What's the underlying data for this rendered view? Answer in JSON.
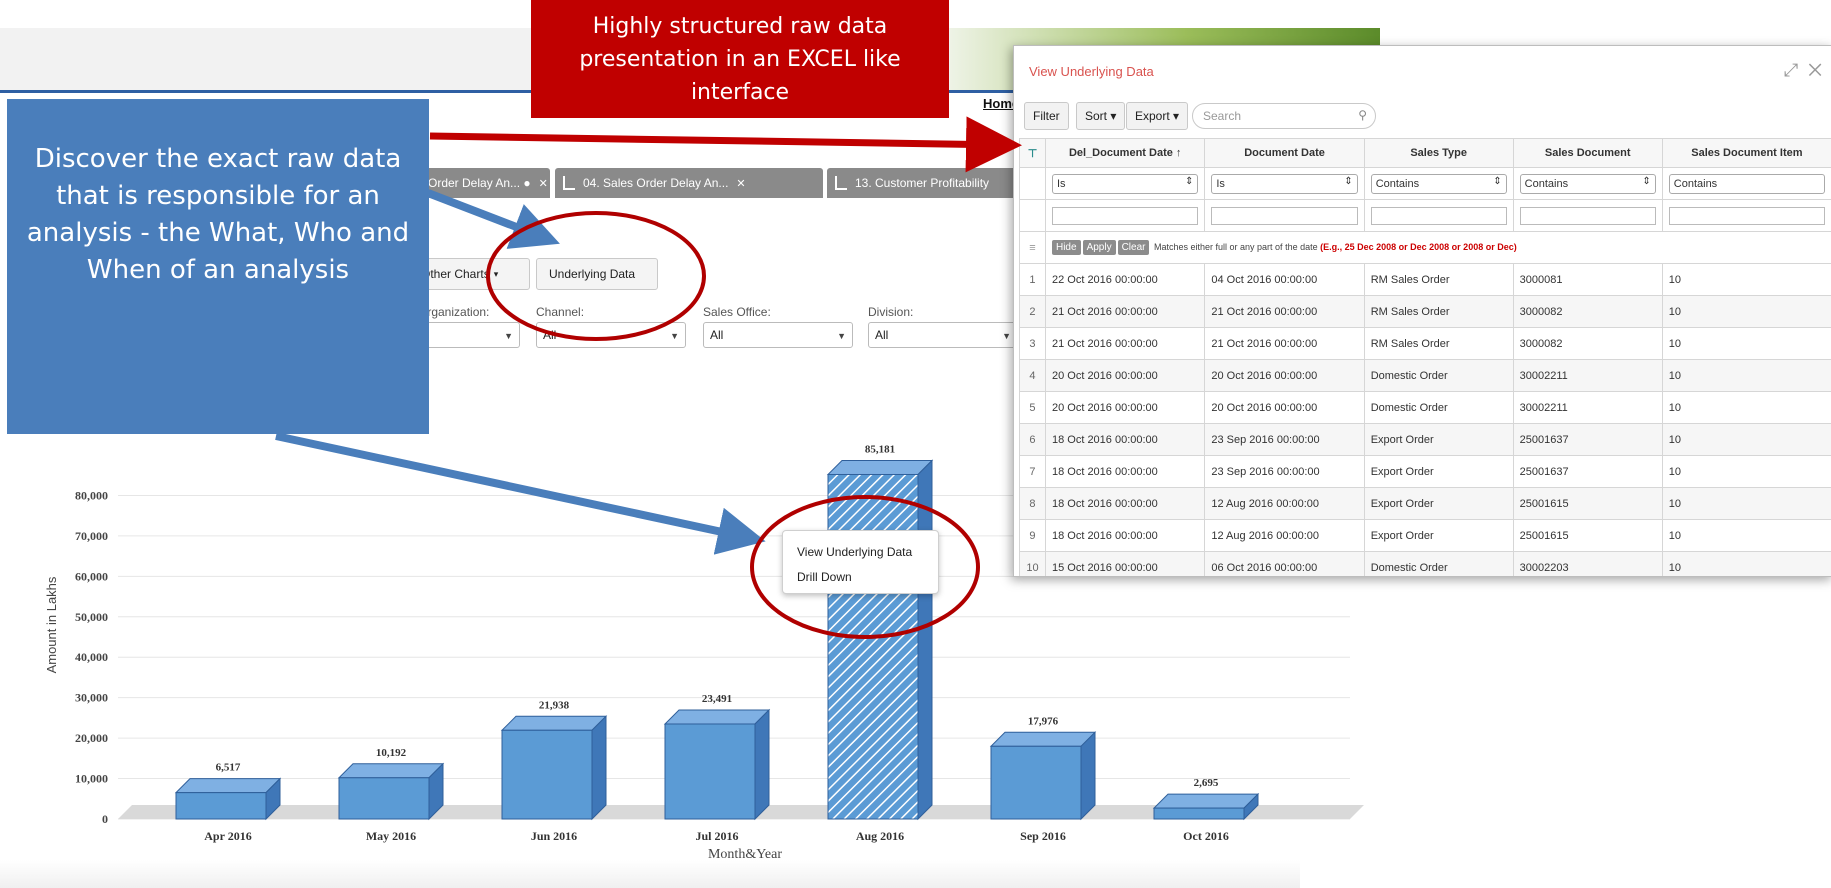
{
  "app": {
    "home_link": "Home",
    "tabs": [
      {
        "label": "Order Delay An... ●"
      },
      {
        "label": "04. Sales Order Delay An..."
      },
      {
        "label": "13. Customer Profitability"
      }
    ],
    "toolbar": {
      "other_charts": "Other Charts",
      "underlying_data": "Underlying Data"
    },
    "filters": [
      {
        "label": "Organization:",
        "value": ""
      },
      {
        "label": "Channel:",
        "value": "All"
      },
      {
        "label": "Sales Office:",
        "value": "All"
      },
      {
        "label": "Division:",
        "value": "All"
      }
    ]
  },
  "chart_data": {
    "type": "bar",
    "categories": [
      "Apr 2016",
      "May 2016",
      "Jun 2016",
      "Jul 2016",
      "Aug 2016",
      "Sep 2016",
      "Oct 2016"
    ],
    "values": [
      6517,
      10192,
      21938,
      23491,
      85181,
      17976,
      2695
    ],
    "data_labels": [
      "6,517",
      "10,192",
      "21,938",
      "23,491",
      "85,181",
      "17,976",
      "2,695"
    ],
    "xlabel": "Month&Year",
    "ylabel": "Amount in Lakhs",
    "yticks": [
      "0",
      "10,000",
      "20,000",
      "30,000",
      "40,000",
      "50,000",
      "60,000",
      "70,000",
      "80,000"
    ],
    "ylim": [
      0,
      90000
    ],
    "highlighted_category": "Aug 2016",
    "bar_color": "#5b9bd5",
    "grid": true
  },
  "context_menu": {
    "items": [
      "View Underlying Data",
      "Drill Down"
    ]
  },
  "data_window": {
    "title": "View Underlying Data",
    "buttons": {
      "filter": "Filter",
      "sort": "Sort ▾",
      "export": "Export ▾"
    },
    "search_placeholder": "Search",
    "columns": [
      "Del_Document Date ↑",
      "Document Date",
      "Sales Type",
      "Sales Document",
      "Sales Document Item"
    ],
    "filter_ops": [
      "Is",
      "Is",
      "Contains",
      "Contains",
      "Contains"
    ],
    "hint": {
      "buttons": [
        "Hide",
        "Apply",
        "Clear"
      ],
      "text": "Matches either full or any part of the date",
      "example": "(E.g., 25 Dec 2008 or Dec 2008 or 2008 or Dec)"
    },
    "rows": [
      [
        "1",
        "22 Oct 2016 00:00:00",
        "04 Oct 2016 00:00:00",
        "RM Sales Order",
        "3000081",
        "10"
      ],
      [
        "2",
        "21 Oct 2016 00:00:00",
        "21 Oct 2016 00:00:00",
        "RM Sales Order",
        "3000082",
        "10"
      ],
      [
        "3",
        "21 Oct 2016 00:00:00",
        "21 Oct 2016 00:00:00",
        "RM Sales Order",
        "3000082",
        "10"
      ],
      [
        "4",
        "20 Oct 2016 00:00:00",
        "20 Oct 2016 00:00:00",
        "Domestic Order",
        "30002211",
        "10"
      ],
      [
        "5",
        "20 Oct 2016 00:00:00",
        "20 Oct 2016 00:00:00",
        "Domestic Order",
        "30002211",
        "10"
      ],
      [
        "6",
        "18 Oct 2016 00:00:00",
        "23 Sep 2016 00:00:00",
        "Export Order",
        "25001637",
        "10"
      ],
      [
        "7",
        "18 Oct 2016 00:00:00",
        "23 Sep 2016 00:00:00",
        "Export Order",
        "25001637",
        "10"
      ],
      [
        "8",
        "18 Oct 2016 00:00:00",
        "12 Aug 2016 00:00:00",
        "Export Order",
        "25001615",
        "10"
      ],
      [
        "9",
        "18 Oct 2016 00:00:00",
        "12 Aug 2016 00:00:00",
        "Export Order",
        "25001615",
        "10"
      ],
      [
        "10",
        "15 Oct 2016 00:00:00",
        "06 Oct 2016 00:00:00",
        "Domestic Order",
        "30002203",
        "10"
      ]
    ]
  },
  "annotations": {
    "blue_callout": "Discover the exact raw data that is responsible for an analysis -  the What, Who and When of an analysis",
    "red_callout": "Highly structured raw data presentation in an EXCEL like interface",
    "blue_color": "#4a7ebb",
    "red_color": "#c00000"
  }
}
